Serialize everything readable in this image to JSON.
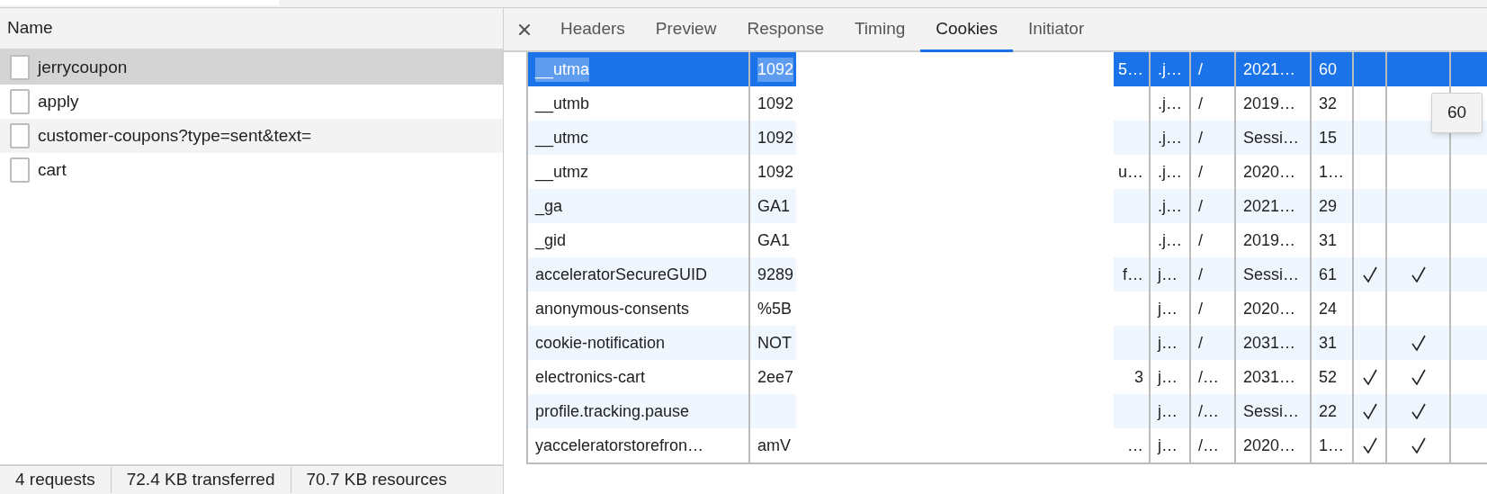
{
  "requests": {
    "header": "Name",
    "items": [
      {
        "name": "jerrycoupon",
        "selected": true
      },
      {
        "name": "apply",
        "selected": false
      },
      {
        "name": "customer-coupons?type=sent&text=",
        "selected": false
      },
      {
        "name": "cart",
        "selected": false
      }
    ]
  },
  "status_bar": [
    "4 requests",
    "72.4 KB transferred",
    "70.7 KB resources"
  ],
  "tabs": [
    {
      "label": "Headers",
      "selected": false
    },
    {
      "label": "Preview",
      "selected": false
    },
    {
      "label": "Response",
      "selected": false
    },
    {
      "label": "Timing",
      "selected": false
    },
    {
      "label": "Cookies",
      "selected": true
    },
    {
      "label": "Initiator",
      "selected": false
    }
  ],
  "cookies": [
    {
      "name": "__utma",
      "value_start": "1092",
      "value_end": "5…",
      "domain": ".j…",
      "path": "/",
      "expires": "2021…",
      "size": "60",
      "http_only": false,
      "secure": false,
      "selected": true
    },
    {
      "name": "__utmb",
      "value_start": "1092",
      "domain": ".j…",
      "path": "/",
      "expires": "2019…",
      "size": "32",
      "http_only": false,
      "secure": false,
      "selected": false
    },
    {
      "name": "__utmc",
      "value_start": "1092",
      "domain": ".j…",
      "path": "/",
      "expires": "Sessi…",
      "size": "15",
      "http_only": false,
      "secure": false,
      "selected": false
    },
    {
      "name": "__utmz",
      "value_start": "1092",
      "value_end": "u…",
      "domain": ".j…",
      "path": "/",
      "expires": "2020…",
      "size": "1…",
      "http_only": false,
      "secure": false,
      "selected": false
    },
    {
      "name": "_ga",
      "value_start": "GA1",
      "domain": ".j…",
      "path": "/",
      "expires": "2021…",
      "size": "29",
      "http_only": false,
      "secure": false,
      "selected": false
    },
    {
      "name": "_gid",
      "value_start": "GA1",
      "domain": ".j…",
      "path": "/",
      "expires": "2019…",
      "size": "31",
      "http_only": false,
      "secure": false,
      "selected": false
    },
    {
      "name": "acceleratorSecureGUID",
      "value_start": "9289",
      "value_end": "f…",
      "domain": "j…",
      "path": "/",
      "expires": "Sessi…",
      "size": "61",
      "http_only": true,
      "secure": true,
      "selected": false
    },
    {
      "name": "anonymous-consents",
      "value_start": "%5B",
      "domain": "j…",
      "path": "/",
      "expires": "2020…",
      "size": "24",
      "http_only": false,
      "secure": false,
      "selected": false
    },
    {
      "name": "cookie-notification",
      "value_start": "NOT",
      "domain": "j…",
      "path": "/",
      "expires": "2031…",
      "size": "31",
      "http_only": false,
      "secure": true,
      "selected": false
    },
    {
      "name": "electronics-cart",
      "value_start": "2ee7",
      "value_end": "3",
      "domain": "j…",
      "path": "/…",
      "expires": "2031…",
      "size": "52",
      "http_only": true,
      "secure": true,
      "selected": false
    },
    {
      "name": "profile.tracking.pause",
      "domain": "j…",
      "path": "/…",
      "expires": "Sessi…",
      "size": "22",
      "http_only": true,
      "secure": true,
      "selected": false
    },
    {
      "name": "yacceleratorstorefron…",
      "value_start": "amV",
      "value_end": "…",
      "domain": "j…",
      "path": "/…",
      "expires": "2020…",
      "size": "1…",
      "http_only": true,
      "secure": true,
      "selected": false
    }
  ],
  "tooltip": "60"
}
